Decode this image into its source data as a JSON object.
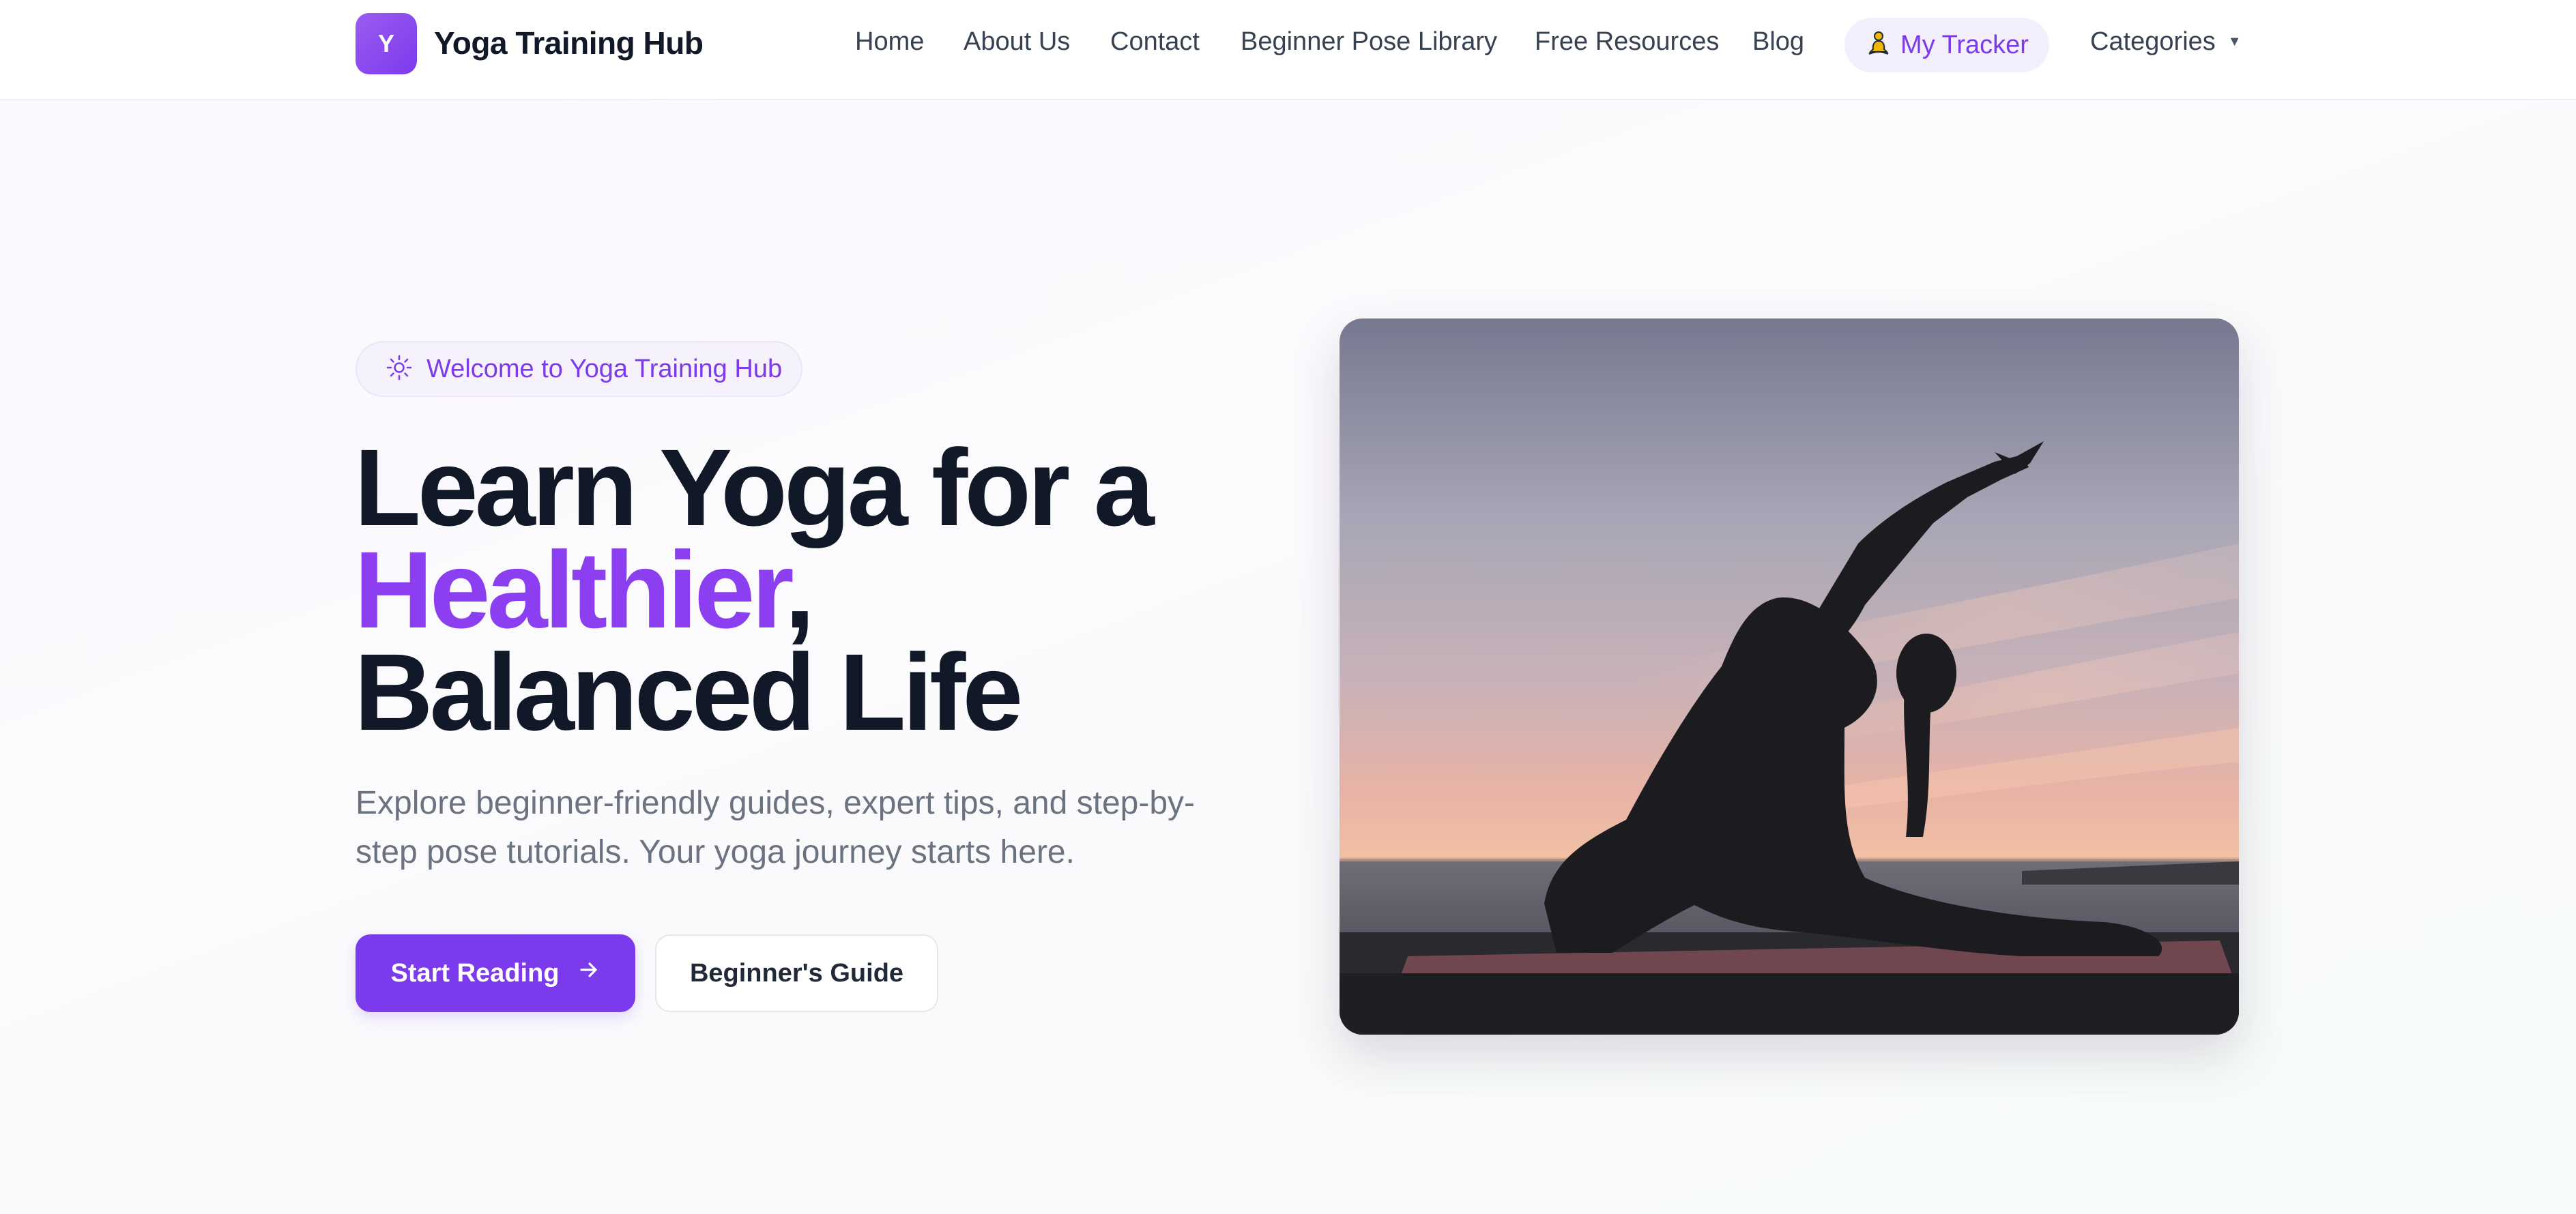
{
  "nav": {
    "logo_letter": "Y",
    "brand": "Yoga Training Hub",
    "links": [
      "Home",
      "About Us",
      "Contact",
      "Beginner Pose Library",
      "Free Resources",
      "Blog"
    ],
    "tracker_label": "My Tracker",
    "tracker_icon": "meditation-figure-icon",
    "categories_label": "Categories"
  },
  "hero": {
    "badge_icon": "sun-icon",
    "badge_label": "Welcome to Yoga Training Hub",
    "title_line1": "Learn Yoga for a",
    "title_accent": "Healthier",
    "title_comma": ",",
    "title_line3": "Balanced Life",
    "subtitle": "Explore beginner-friendly guides, expert tips, and step-by-step pose tutorials. Your yoga journey starts here.",
    "primary_button": "Start Reading",
    "primary_button_icon": "arrow-right-icon",
    "secondary_button": "Beginner's Guide",
    "image_subject": "yoga-silhouette-at-sunset"
  },
  "colors": {
    "accent": "#7c3aed",
    "accent_text": "#8b3ff0",
    "heading": "#111827",
    "body_text": "#6b7280"
  }
}
